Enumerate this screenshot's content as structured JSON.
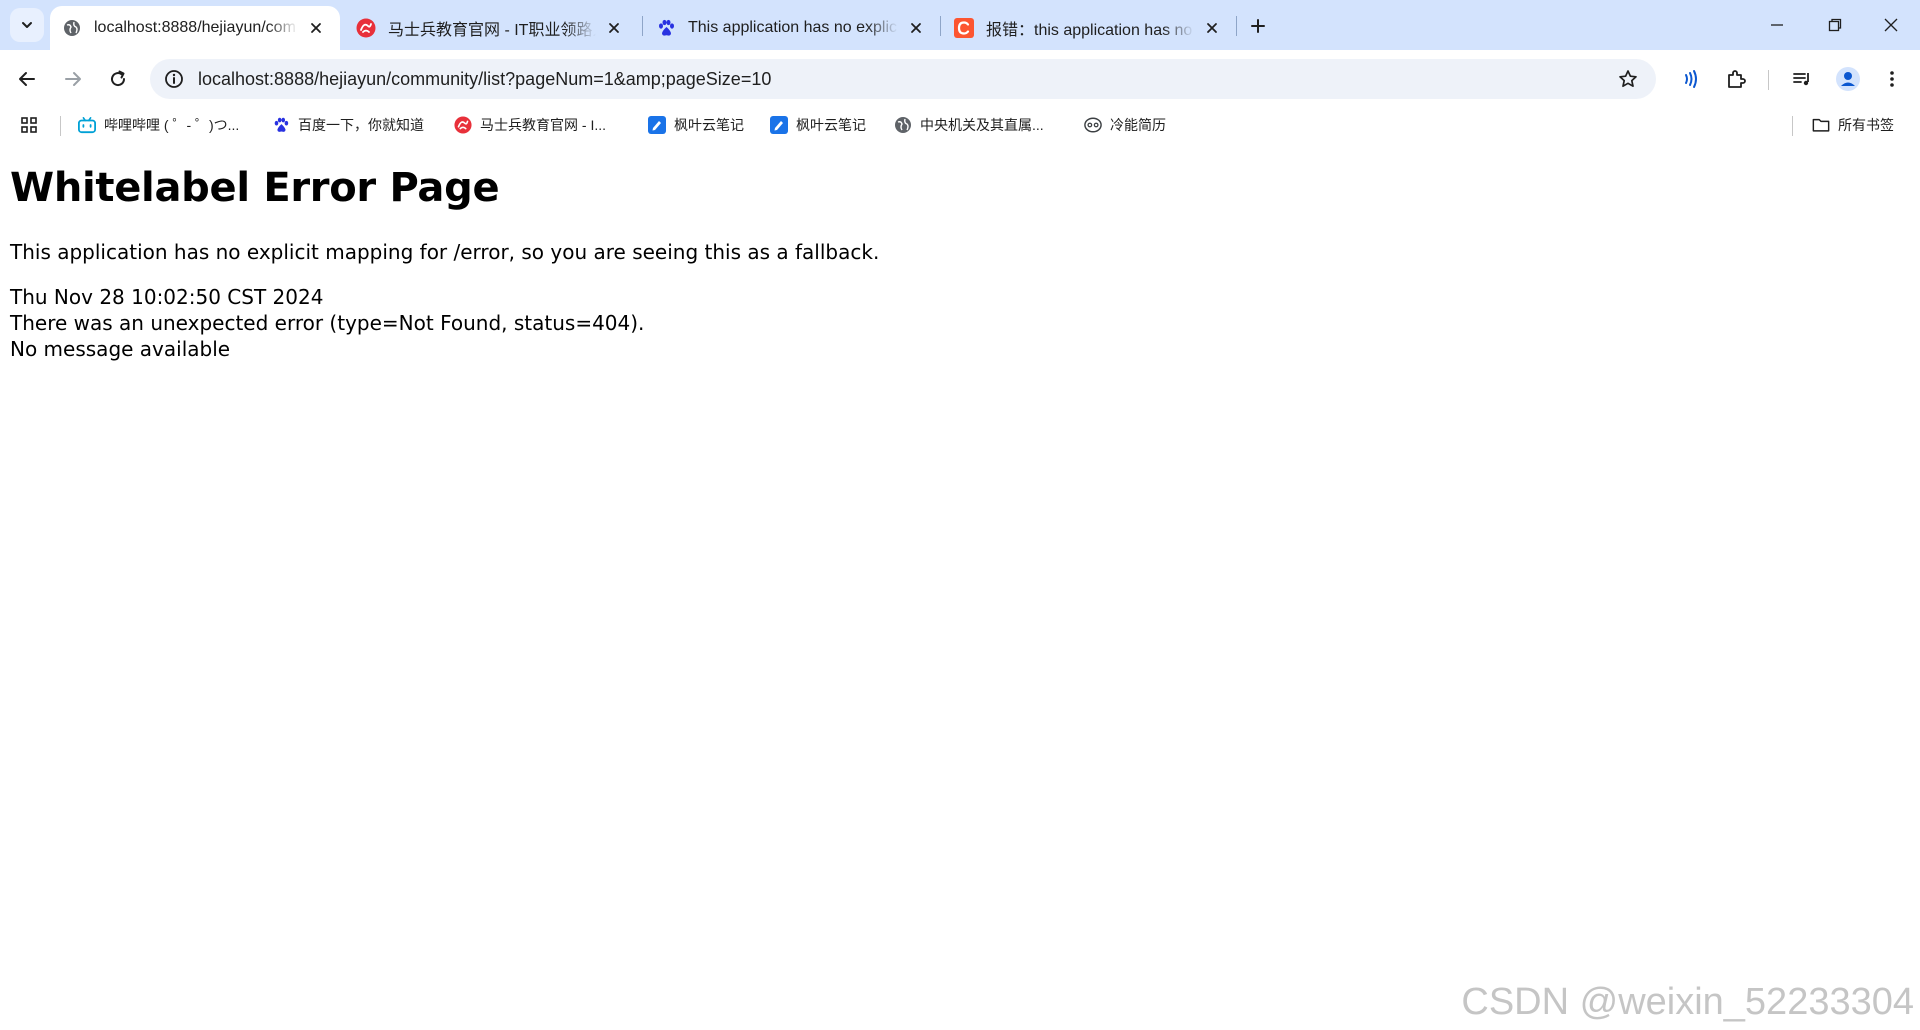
{
  "tabs": [
    {
      "title": "localhost:8888/hejiayun/com",
      "favicon": "globe-icon",
      "active": true
    },
    {
      "title": "马士兵教育官网 - IT职业领路人",
      "favicon": "msb-logo-icon",
      "active": false
    },
    {
      "title": "This application has no explic",
      "favicon": "baidu-paw-icon",
      "active": false
    },
    {
      "title": "报错：this application has no",
      "favicon": "csdn-c-icon",
      "active": false
    }
  ],
  "address_bar": {
    "url": "localhost:8888/hejiayun/community/list?pageNum=1&amp;pageSize=10"
  },
  "bookmarks": [
    {
      "label": "哔哩哔哩 ( ゜- ゜)つ...",
      "icon": "bilibili-icon"
    },
    {
      "label": "百度一下，你就知道",
      "icon": "baidu-paw-icon"
    },
    {
      "label": "马士兵教育官网 - I...",
      "icon": "msb-logo-icon"
    },
    {
      "label": "枫叶云笔记",
      "icon": "note-icon"
    },
    {
      "label": "枫叶云笔记",
      "icon": "note-icon"
    },
    {
      "label": "中央机关及其直属...",
      "icon": "globe-icon"
    },
    {
      "label": "冷能简历",
      "icon": "resume-icon"
    }
  ],
  "all_bookmarks_label": "所有书签",
  "page": {
    "heading": "Whitelabel Error Page",
    "description": "This application has no explicit mapping for /error, so you are seeing this as a fallback.",
    "timestamp": "Thu Nov 28 10:02:50 CST 2024",
    "error_line": "There was an unexpected error (type=Not Found, status=404).",
    "message": "No message available"
  },
  "watermark": "CSDN @weixin_52233304",
  "colors": {
    "tabstrip": "#d3e3fd",
    "omnibox": "#eef2f9",
    "accent": "#0b57d0"
  }
}
